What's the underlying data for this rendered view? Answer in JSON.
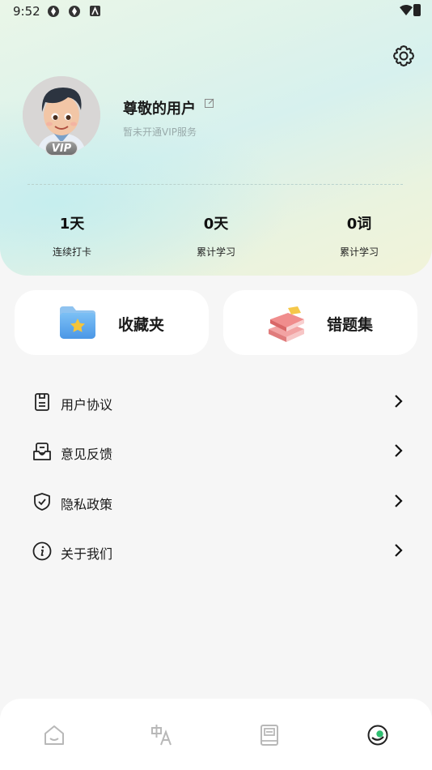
{
  "status_bar": {
    "time": "9:52"
  },
  "profile": {
    "username": "尊敬的用户",
    "vip_status": "暂未开通VIP服务",
    "vip_badge": "VIP"
  },
  "stats": [
    {
      "value": "1天",
      "label": "连续打卡"
    },
    {
      "value": "0天",
      "label": "累计学习"
    },
    {
      "value": "0词",
      "label": "累计学习"
    }
  ],
  "cards": {
    "favorites": "收藏夹",
    "wrong_questions": "错题集"
  },
  "menu": [
    {
      "label": "用户协议",
      "icon": "document-icon"
    },
    {
      "label": "意见反馈",
      "icon": "feedback-icon"
    },
    {
      "label": "隐私政策",
      "icon": "shield-icon"
    },
    {
      "label": "关于我们",
      "icon": "info-icon"
    }
  ],
  "bottom_nav": [
    "home-icon",
    "translate-icon",
    "book-icon",
    "profile-icon"
  ],
  "colors": {
    "accent_green": "#2fbf71",
    "header_gradient_start": "#eaf6e8",
    "header_gradient_end": "#f1f3d9"
  }
}
